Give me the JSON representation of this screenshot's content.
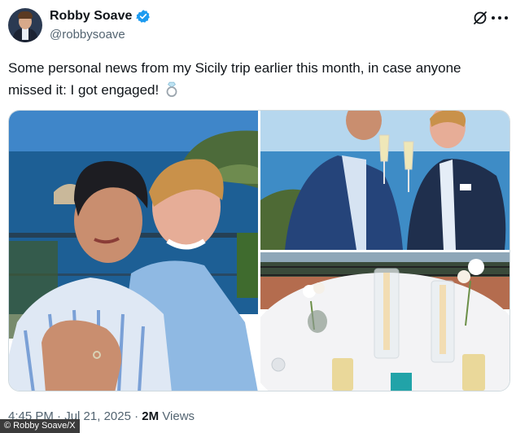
{
  "author": {
    "display_name": "Robby Soave",
    "handle": "@robbysoave",
    "verified": true,
    "avatar_icon": "profile-photo"
  },
  "tweet": {
    "text": "Some personal news from my Sicily trip earlier this month, in case anyone missed it: I got engaged!",
    "emoji_icon": "ring-icon"
  },
  "media": {
    "photo_count": 3
  },
  "meta": {
    "time": "4:45 PM",
    "date": "Jul 21, 2025",
    "separator": "·",
    "views_count": "2M",
    "views_label": "Views"
  },
  "credit": "© Robby Soave/X",
  "colors": {
    "text_primary": "#0f1419",
    "text_secondary": "#536471",
    "verified_blue": "#1d9bf0",
    "border": "#cfd9de"
  }
}
